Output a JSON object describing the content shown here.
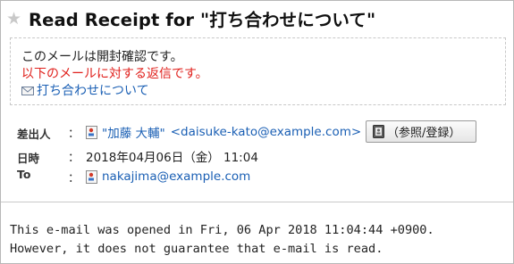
{
  "title": "Read Receipt for \"打ち合わせについて\"",
  "notice": {
    "line1": "このメールは開封確認です。",
    "line2": "以下のメールに対する返信です。",
    "original_link": "打ち合わせについて"
  },
  "headers": {
    "from_label": "差出人",
    "from_name": "\"加藤 大輔\"",
    "from_email": "<daisuke-kato@example.com>",
    "ref_button": "（参照/登録）",
    "date_label": "日時",
    "date_value": "2018年04月06日（金） 11:04",
    "to_label": "To",
    "to_value": "nakajima@example.com",
    "colon": "："
  },
  "body": {
    "line1": "This e-mail was opened in Fri, 06 Apr 2018 11:04:44 +0900.",
    "line2": "However, it does not guarantee that e-mail is read."
  },
  "icons": {
    "star": "star-icon",
    "mail": "envelope-icon",
    "contact": "contact-card-icon",
    "address_book": "address-book-icon"
  }
}
